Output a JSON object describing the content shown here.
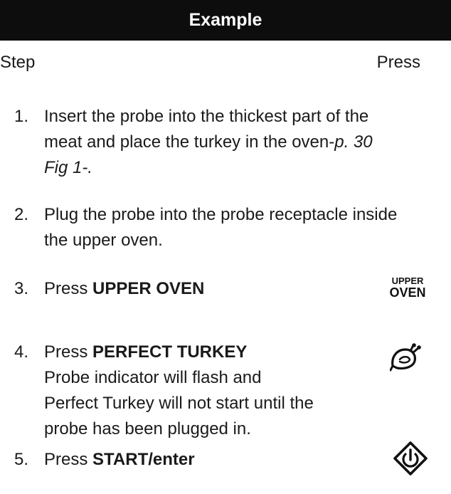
{
  "header": {
    "title": "Example"
  },
  "columns": {
    "step": "Step",
    "press": "Press"
  },
  "steps": [
    {
      "number": "1.",
      "lines": [
        "Insert the probe into the thickest part of the",
        "meat and place the turkey in the oven-",
        "p. 30",
        "Fig 1-."
      ]
    },
    {
      "number": "2.",
      "lines": [
        "Plug the probe into the probe receptacle inside",
        "the upper oven."
      ]
    },
    {
      "number": "3.",
      "prefix": "Press ",
      "key": "UPPER OVEN"
    },
    {
      "number": "4.",
      "prefix": "Press ",
      "key": "PERFECT TURKEY",
      "lines": [
        "Probe indicator will flash and",
        "Perfect Turkey will not start until the",
        "probe has been plugged in."
      ]
    },
    {
      "number": "5.",
      "prefix": "Press ",
      "key": "START/enter"
    }
  ],
  "keypad": {
    "upper_oven": {
      "line1": "UPPER",
      "line2": "OVEN"
    },
    "perfect_turkey_icon": "turkey-icon",
    "start_enter_icon": "start-enter-icon"
  }
}
